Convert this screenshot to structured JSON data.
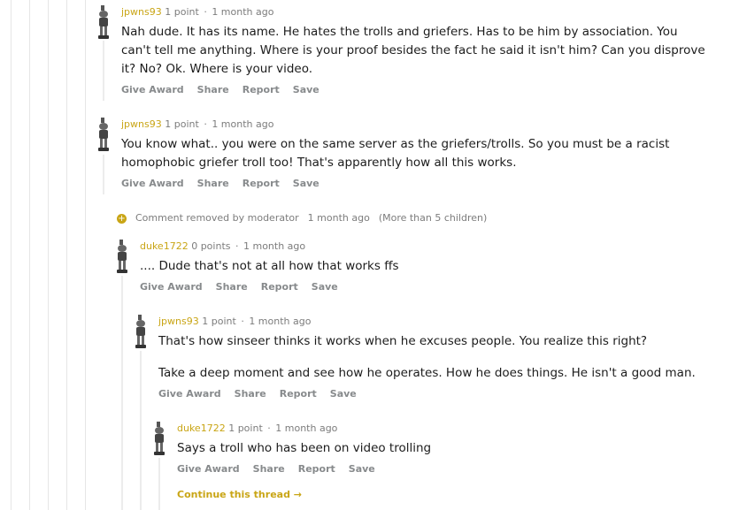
{
  "comments": [
    {
      "author": "jpwns93",
      "score": "1 point",
      "time": "1 month ago",
      "body": [
        "Nah dude. It has its name. He hates the trolls and griefers. Has to be him by association. You can't tell me anything. Where is your proof besides the fact he said it isn't him? Can you disprove it? No? Ok. Where is your video."
      ]
    },
    {
      "author": "jpwns93",
      "score": "1 point",
      "time": "1 month ago",
      "body": [
        "You know what.. you were on the same server as the griefers/trolls. So you must be a racist homophobic griefer troll too! That's apparently how all this works."
      ]
    },
    {
      "author": "duke1722",
      "score": "0 points",
      "time": "1 month ago",
      "body": [
        ".... Dude that's not at all how that works ffs"
      ]
    },
    {
      "author": "jpwns93",
      "score": "1 point",
      "time": "1 month ago",
      "body": [
        "That's how sinseer thinks it works when he excuses people. You realize this right?",
        "Take a deep moment and see how he operates. How he does things. He isn't a good man."
      ]
    },
    {
      "author": "duke1722",
      "score": "1 point",
      "time": "1 month ago",
      "body": [
        "Says a troll who has been on video trolling"
      ]
    }
  ],
  "actions": {
    "give_award": "Give Award",
    "share": "Share",
    "report": "Report",
    "save": "Save"
  },
  "removed": {
    "icon": "plus-circle-icon",
    "text": "Comment removed by moderator",
    "time": "1 month ago",
    "children": "(More than 5 children)"
  },
  "continue_thread": "Continue this thread →",
  "colors": {
    "author": "#c9a515",
    "meta": "#7c7c7c",
    "action": "#878a8c"
  }
}
